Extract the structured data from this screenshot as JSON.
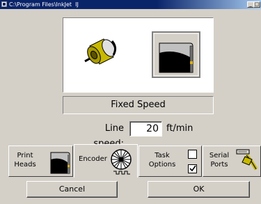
{
  "window": {
    "title": "C:\\Program Files\\InkJet  IJ",
    "minimize_label": "_",
    "maximize_label": "□"
  },
  "display": {
    "mode_label": "Fixed Speed"
  },
  "line_speed": {
    "label": "Line speed:",
    "value": "20",
    "unit": "ft/min"
  },
  "tabs": [
    {
      "label_line1": "Print",
      "label_line2": "Heads",
      "icon": "print-head-icon"
    },
    {
      "label": "Encoder",
      "icon": "encoder-wheel-icon",
      "active": true
    },
    {
      "label_line1": "Task",
      "label_line2": "Options",
      "icon": "checkbox-icons",
      "checkbox_top_checked": false,
      "checkbox_bottom_checked": true
    },
    {
      "label_line1": "Serial",
      "label_line2": "Ports",
      "icon": "serial-cable-icon"
    }
  ],
  "buttons": {
    "cancel_label": "Cancel",
    "ok_label": "OK"
  },
  "colors": {
    "titlebar": "#0a246a",
    "face": "#d4d0c8"
  }
}
